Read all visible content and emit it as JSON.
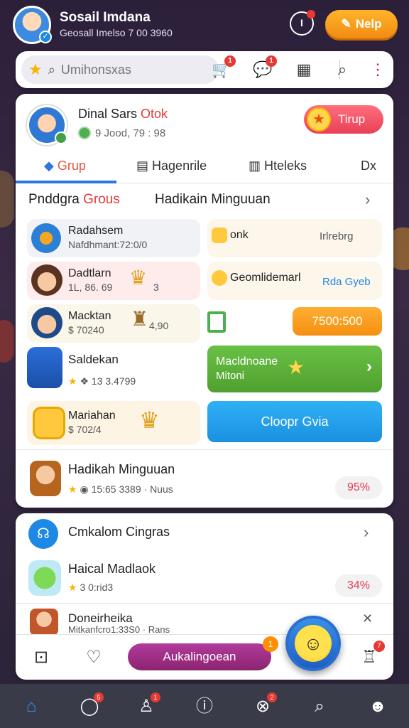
{
  "header": {
    "user_name": "Sosail Imdana",
    "user_sub": "Geosall Imelso 7 00 3960",
    "bell_label": "I",
    "notif_label": "Nelp"
  },
  "search": {
    "placeholder": "Umihonsxas",
    "icon_badges": [
      "1",
      "1"
    ]
  },
  "profile": {
    "name_main": "Dinal Sars ",
    "name_hl": "Otok",
    "sub": "9 Jood, 79 : 98",
    "join_label": "Tirup"
  },
  "tabs": [
    {
      "label": "Grup",
      "active": true
    },
    {
      "label": "Hagenrile",
      "active": false
    },
    {
      "label": "Hteleks",
      "active": false
    },
    {
      "label": "Dx",
      "active": false
    }
  ],
  "section": {
    "title_main": "Pnddgra ",
    "title_hl": "Grous",
    "title2": "Hadikain Minguuan"
  },
  "left_tiles": [
    {
      "title": "Radahsem",
      "sub": "Nafdhmant:72:0/0"
    },
    {
      "title": "Dadtlarn",
      "sub": "1L, 86. 69",
      "extra": "3"
    },
    {
      "title": "Macktan",
      "sub": "$ 70240",
      "extra": "4,90"
    },
    {
      "title": "Saldekan",
      "sub": "13 3.4799"
    },
    {
      "title": "Mariahan",
      "sub": "$ 702/4"
    }
  ],
  "right_tiles": [
    {
      "title": "onk",
      "sub": "Irlrebrg"
    },
    {
      "title": "Geomlidemarl",
      "sub": "Rda Gyeb"
    }
  ],
  "buttons": {
    "orange": "7500:500",
    "green_l1": "Macldnoane",
    "green_l2": "Mitoni",
    "blue": "Cloopr Gvia"
  },
  "rows": [
    {
      "title": "Hadikah Minguuan",
      "sub": "15:65 3389 · Nuus",
      "pct": "95%"
    },
    {
      "title": "Cmkalom Cingras",
      "sub": "",
      "pct": ""
    },
    {
      "title": "Haical Madlaok",
      "sub": "3 0:rid3",
      "pct": "34%"
    },
    {
      "title": "Doneirheika",
      "sub": "Mitkanfcro1:33S0 · Rans",
      "pct": ""
    }
  ],
  "actionbar": {
    "main_label": "Aukalingoean",
    "main_badge": "1",
    "right_badge": "7"
  },
  "nav_badges": [
    "5",
    "1",
    "2"
  ],
  "colors": {
    "accent_blue": "#2f74e0",
    "accent_red": "#e53935",
    "orange": "#f59010",
    "green": "#4fa02e",
    "purple": "#8b2470"
  }
}
